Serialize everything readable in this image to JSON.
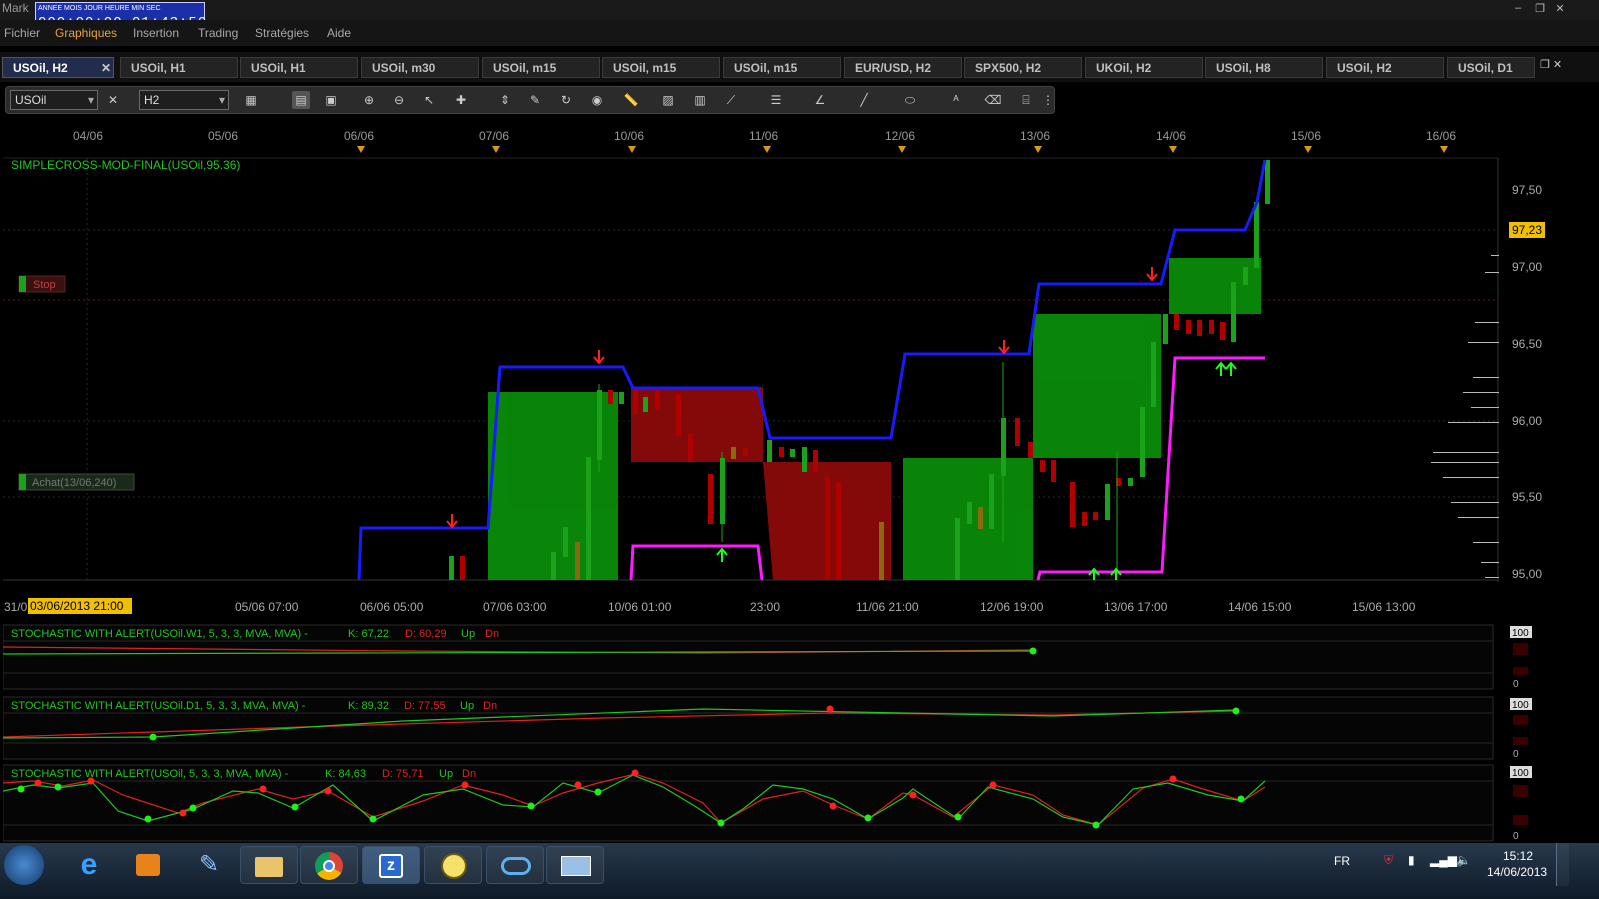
{
  "window": {
    "app_title": "Mark",
    "clock": {
      "labels": "ANNEE  MOIS  JOUR  HEURE  MIN  SEC",
      "values": "000:00:00 01:43:50"
    }
  },
  "menu": [
    "Fichier",
    "Graphiques",
    "Insertion",
    "Trading",
    "Stratégies",
    "Aide"
  ],
  "tabs": [
    "USOil, H2",
    "USOil, H1",
    "USOil, H1",
    "USOil, m30",
    "USOil, m15",
    "USOil, m15",
    "USOil, m15",
    "EUR/USD, H2",
    "SPX500, H2",
    "UKOil, H2",
    "USOil, H8",
    "USOil, H2",
    "USOil, D1"
  ],
  "toolbar": {
    "symbol": "USOil",
    "timeframe": "H2"
  },
  "chart": {
    "top_dates": [
      "04/06",
      "05/06",
      "06/06",
      "07/06",
      "10/06",
      "11/06",
      "12/06",
      "13/06",
      "14/06",
      "15/06",
      "16/06"
    ],
    "indicator_label": "SIMPLECROSS-MOD-FINAL(USOil,95.36)",
    "price_ticks": [
      "97,50",
      "97,00",
      "96,50",
      "96,00",
      "95,50",
      "95,00"
    ],
    "current_price": "97,23",
    "stop_label": "Stop",
    "buy_label": "Achat(13/06,240)",
    "bottom_left_date": "31/0",
    "cursor_date": "03/06/2013 21:00",
    "bottom_times": [
      "05/06 07:00",
      "06/06 05:00",
      "07/06 03:00",
      "10/06 01:00",
      "23:00",
      "11/06 21:00",
      "12/06 19:00",
      "13/06 17:00",
      "14/06 15:00",
      "15/06 13:00"
    ]
  },
  "stoch": [
    {
      "label": "STOCHASTIC WITH ALERT(USOil.W1, 5, 3, 3, MVA, MVA) -",
      "k": "K: 67,22",
      "d": "D: 60,29",
      "up": "Up",
      "dn": "Dn",
      "max": "100",
      "min": "0"
    },
    {
      "label": "STOCHASTIC WITH ALERT(USOil.D1, 5, 3, 3, MVA, MVA) -",
      "k": "K: 89,32",
      "d": "D: 77,55",
      "up": "Up",
      "dn": "Dn",
      "max": "100",
      "min": "0"
    },
    {
      "label": "STOCHASTIC WITH ALERT(USOil, 5, 3, 3, MVA, MVA) -",
      "k": "K: 84,63",
      "d": "D: 75,71",
      "up": "Up",
      "dn": "Dn",
      "max": "100",
      "min": "0"
    }
  ],
  "taskbar": {
    "lang": "FR",
    "time": "15:12",
    "date": "14/06/2013"
  },
  "colors": {
    "bull": "#1aa31a",
    "bear": "#b00000",
    "upper_band": "#1a1aff",
    "lower_band": "#ff1aff",
    "zone_green": "#0a8c0a",
    "zone_red": "#8c0a0a"
  }
}
